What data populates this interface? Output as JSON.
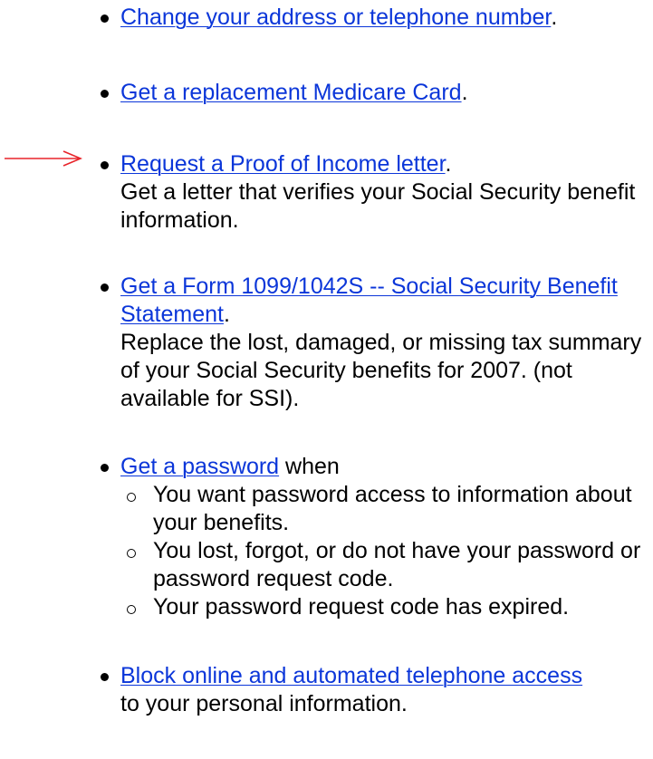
{
  "colors": {
    "link": "#0b36d9",
    "arrow": "#e8242a",
    "text": "#000000"
  },
  "items": [
    {
      "link": "Change your address or telephone number",
      "suffix": "."
    },
    {
      "link": "Get a replacement Medicare Card",
      "suffix": "."
    },
    {
      "link": "Request a Proof of Income letter",
      "suffix": ".",
      "description": "Get a letter that verifies your Social Security benefit information."
    },
    {
      "link": "Get a Form 1099/1042S -- Social Security Benefit Statement",
      "suffix": ".",
      "description": "Replace the lost, damaged, or missing tax summary of your Social Security benefits for 2007. (not available for SSI)."
    },
    {
      "link": "Get a password",
      "suffix": " when",
      "subitems": [
        "You want password access to information about your benefits.",
        "You lost, forgot, or do not have your password or password request code.",
        "Your password request code has expired."
      ]
    },
    {
      "link": "Block online and automated telephone access",
      "description": "to your personal information."
    }
  ],
  "annotation": {
    "icon": "right-arrow-icon",
    "points_to": "Request a Proof of Income letter"
  }
}
